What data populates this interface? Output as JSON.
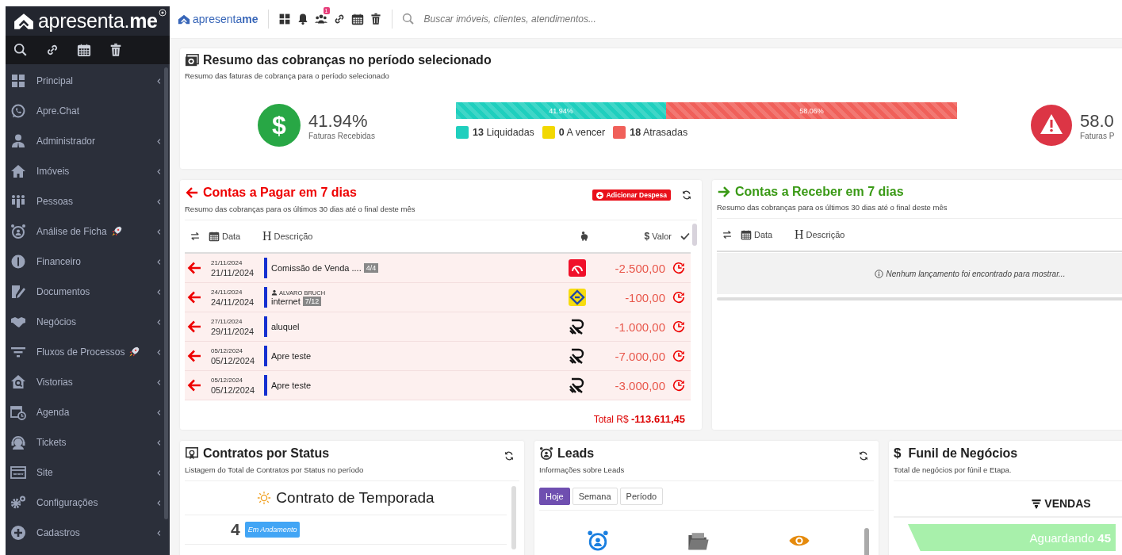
{
  "sidebar": {
    "logo": "apresenta.**me**",
    "items": [
      {
        "label": "Principal",
        "expandable": true,
        "rocket": false
      },
      {
        "label": "Apre.Chat",
        "expandable": false,
        "rocket": false
      },
      {
        "label": "Administrador",
        "expandable": true,
        "rocket": false
      },
      {
        "label": "Imóveis",
        "expandable": true,
        "rocket": false
      },
      {
        "label": "Pessoas",
        "expandable": true,
        "rocket": false
      },
      {
        "label": "Análise de Ficha",
        "expandable": true,
        "rocket": true
      },
      {
        "label": "Financeiro",
        "expandable": true,
        "rocket": false
      },
      {
        "label": "Documentos",
        "expandable": true,
        "rocket": false
      },
      {
        "label": "Negócios",
        "expandable": true,
        "rocket": false
      },
      {
        "label": "Fluxos de Processos",
        "expandable": true,
        "rocket": true
      },
      {
        "label": "Vistorias",
        "expandable": true,
        "rocket": false
      },
      {
        "label": "Agenda",
        "expandable": true,
        "rocket": false
      },
      {
        "label": "Tickets",
        "expandable": true,
        "rocket": false
      },
      {
        "label": "Site",
        "expandable": true,
        "rocket": false
      },
      {
        "label": "Configurações",
        "expandable": true,
        "rocket": false
      },
      {
        "label": "Cadastros",
        "expandable": true,
        "rocket": false
      }
    ]
  },
  "header": {
    "logo": "apresenta**me**",
    "notification_count": "1",
    "search_placeholder": "Buscar imóveis, clientes, atendimentos..."
  },
  "summary": {
    "title": "Resumo das cobranças no período selecionado",
    "subtitle": "Resumo das faturas de cobrança para o período selecionado",
    "received": {
      "symbol": "$",
      "value": "41.94%",
      "label": "Faturas Recebidas"
    },
    "bar": [
      {
        "label": "41.94%",
        "level": 0.4194,
        "color": "#1fcfbe"
      },
      {
        "label": "58.06%",
        "color": "#f0605a"
      }
    ],
    "legend": [
      {
        "text": "**13** Liquidadas",
        "color": "#1fcfbe"
      },
      {
        "text": "**0** A vencer",
        "color": "#f2d800"
      },
      {
        "text": "**18** Atrasadas",
        "color": "#f0605a"
      }
    ],
    "pending": {
      "value": "58.0",
      "label": "Faturas P"
    }
  },
  "payables": {
    "title": "Contas a **Pagar** em **7 dias**",
    "subtitle": "Resumo das cobranças para os últimos 30 dias até o final deste mês",
    "add_button": "Adicionar Despesa",
    "columns": {
      "date": "Data",
      "description_mark": "H",
      "description": "Descrição",
      "value_mark": "$",
      "value": "Valor"
    },
    "rows": [
      {
        "due": "21/11/2024",
        "date": "21/11/2024",
        "description": "Comissão de Venda ....",
        "installment": "4/4",
        "logo": {
          "kind": "red-tile"
        },
        "value": "-2.500,00"
      },
      {
        "due": "24/11/2024",
        "date": "24/11/2024",
        "person": "ALVARO BRUCH",
        "description": "internet",
        "installment": "7/12",
        "logo": {
          "kind": "yellow-tile"
        },
        "value": "-100,00"
      },
      {
        "due": "27/11/2024",
        "date": "29/11/2024",
        "description": "aluquel",
        "logo": {
          "kind": "stripes"
        },
        "value": "-1.000,00"
      },
      {
        "due": "05/12/2024",
        "date": "05/12/2024",
        "description": "Apre teste",
        "logo": {
          "kind": "stripes"
        },
        "value": "-7.000,00"
      },
      {
        "due": "05/12/2024",
        "date": "05/12/2024",
        "description": "Apre teste",
        "logo": {
          "kind": "stripes"
        },
        "value": "-3.000,00"
      }
    ],
    "total": "Total R$ **-113.611,45**"
  },
  "receivables": {
    "title": "Contas a **Receber** em **7 dias**",
    "subtitle": "Resumo das cobranças para os últimos 30 dias até o final deste mês",
    "columns": {
      "date": "Data",
      "description_mark": "H",
      "description": "Descrição"
    },
    "empty": "Nenhum lançamento foi encontrado para mostrar..."
  },
  "contracts": {
    "title": "Contratos por Status",
    "subtitle": "Listagem do Total de Contratos por Status no período",
    "group": "Contrato de Temporada",
    "count": "4",
    "status": "Em Andamento"
  },
  "leads": {
    "title": "Leads",
    "subtitle": "Informações sobre Leads",
    "tabs": [
      {
        "label": "Hoje",
        "selected": true
      },
      {
        "label": "Semana",
        "selected": false
      },
      {
        "label": "Período",
        "selected": false
      }
    ]
  },
  "funnel": {
    "mark": "$",
    "title": "Funil de Negócios",
    "subtitle": "Total de negócios por fúnil e Etapa.",
    "pipeline": "VENDAS",
    "stages": [
      {
        "label": "Aguardando",
        "count": "45"
      }
    ]
  }
}
